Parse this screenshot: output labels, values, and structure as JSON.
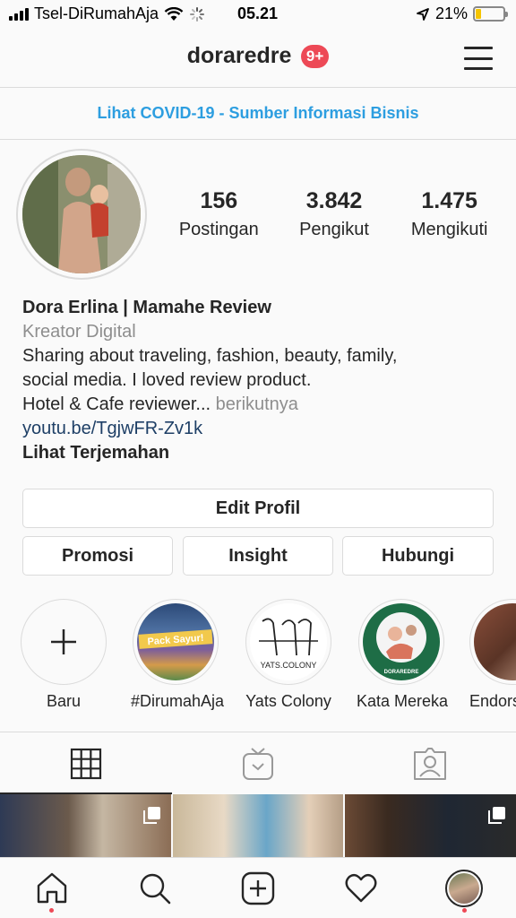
{
  "status_bar": {
    "carrier": "Tsel-DiRumahAja",
    "time": "05.21",
    "battery": "21%",
    "battery_level": 0.21
  },
  "header": {
    "username": "doraredre",
    "notification_badge": "9+"
  },
  "banner": {
    "text": "Lihat COVID-19 - Sumber Informasi Bisnis"
  },
  "profile": {
    "stats": [
      {
        "value": "156",
        "label": "Postingan"
      },
      {
        "value": "3.842",
        "label": "Pengikut"
      },
      {
        "value": "1.475",
        "label": "Mengikuti"
      }
    ],
    "name": "Dora Erlina | Mamahe Review",
    "category": "Kreator Digital",
    "bio_line1": "Sharing about traveling, fashion, beauty, family,",
    "bio_line2": "social media. I loved review product.",
    "bio_line3": "Hotel & Cafe reviewer...",
    "bio_more": "berikutnya",
    "link": "youtu.be/TgjwFR-Zv1k",
    "translate": "Lihat Terjemahan"
  },
  "buttons": {
    "edit": "Edit Profil",
    "promo": "Promosi",
    "insight": "Insight",
    "contact": "Hubungi"
  },
  "highlights": [
    {
      "label": "Baru"
    },
    {
      "label": "#DirumahAja",
      "image_text": "Pack Sayur!"
    },
    {
      "label": "Yats Colony",
      "image_text": "YATS.COLONY"
    },
    {
      "label": "Kata Mereka",
      "image_text": "DORAREDRE"
    },
    {
      "label": "Endors"
    }
  ],
  "colors": {
    "accent_blue": "#2d9ee0",
    "badge_red": "#ed4956",
    "link_dark": "#1e3f66"
  }
}
